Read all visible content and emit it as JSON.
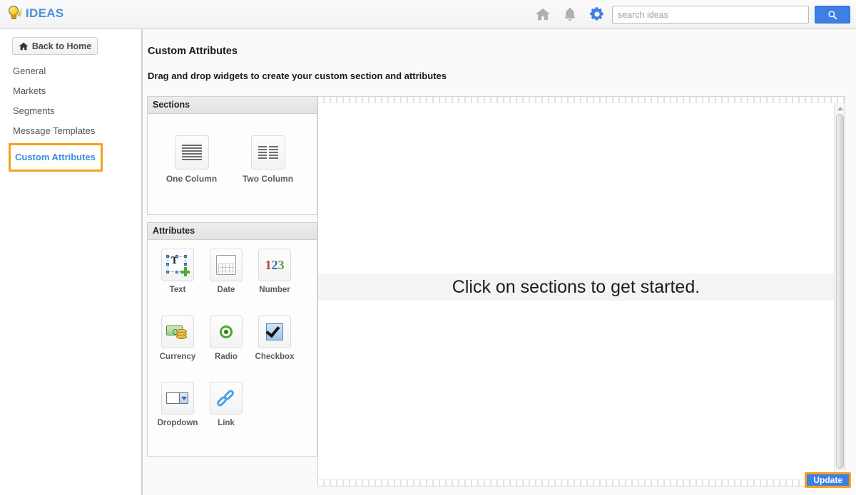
{
  "brand": {
    "name": "IDEAS",
    "icon": "lightbulb-icon"
  },
  "topbar": {
    "icons": [
      {
        "name": "home-icon",
        "label": "Home"
      },
      {
        "name": "bell-icon",
        "label": "Notifications"
      },
      {
        "name": "gear-icon",
        "label": "Settings"
      }
    ],
    "search": {
      "placeholder": "search ideas",
      "value": "",
      "button_icon": "search-icon"
    }
  },
  "sidebar": {
    "back_home": {
      "label": "Back to Home",
      "icon": "home-icon"
    },
    "items": [
      {
        "label": "General",
        "active": false
      },
      {
        "label": "Markets",
        "active": false
      },
      {
        "label": "Segments",
        "active": false
      },
      {
        "label": "Message Templates",
        "active": false
      },
      {
        "label": "Custom Attributes",
        "active": true
      }
    ]
  },
  "main": {
    "title": "Custom Attributes",
    "subtitle": "Drag and drop widgets to create your custom section and attributes",
    "sections_panel": {
      "header": "Sections",
      "widgets": [
        {
          "label": "One Column",
          "icon": "one-column-icon"
        },
        {
          "label": "Two Column",
          "icon": "two-column-icon"
        }
      ]
    },
    "attributes_panel": {
      "header": "Attributes",
      "widgets": [
        {
          "label": "Text",
          "icon": "text-attribute-icon"
        },
        {
          "label": "Date",
          "icon": "date-attribute-icon"
        },
        {
          "label": "Number",
          "icon": "number-attribute-icon"
        },
        {
          "label": "Currency",
          "icon": "currency-attribute-icon"
        },
        {
          "label": "Radio",
          "icon": "radio-attribute-icon"
        },
        {
          "label": "Checkbox",
          "icon": "checkbox-attribute-icon"
        },
        {
          "label": "Dropdown",
          "icon": "dropdown-attribute-icon"
        },
        {
          "label": "Link",
          "icon": "link-attribute-icon"
        }
      ]
    },
    "canvas": {
      "empty_message": "Click on sections to get started."
    },
    "update_button": "Update"
  },
  "colors": {
    "brand_blue": "#4a8fe0",
    "accent_orange": "#f5a11b",
    "button_blue": "#3d7fe4",
    "gear_blue": "#3d7fe4",
    "icon_gray": "#b0b0b0"
  }
}
